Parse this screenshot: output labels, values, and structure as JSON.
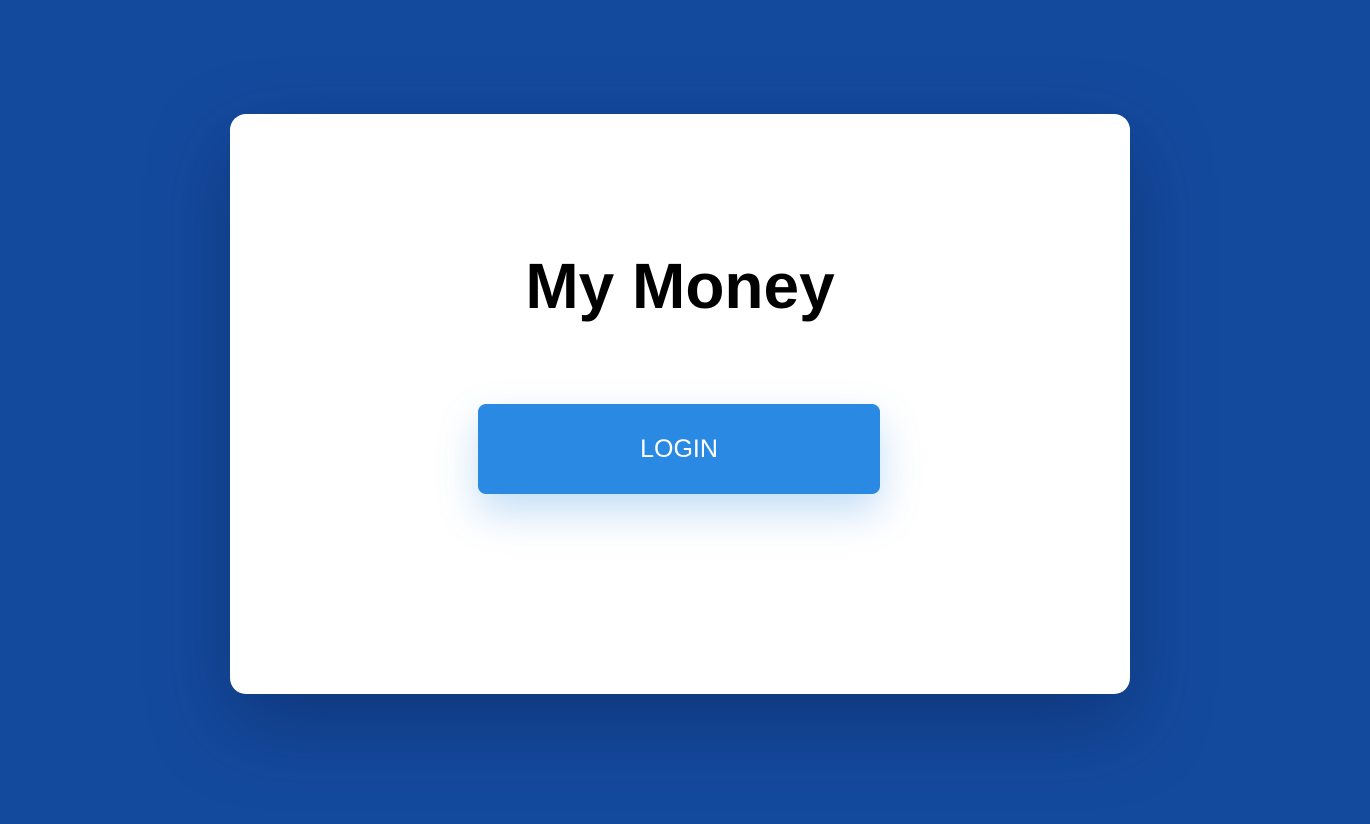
{
  "app": {
    "title": "My Money"
  },
  "actions": {
    "login_label": "LOGIN"
  },
  "colors": {
    "background": "#144a9e",
    "card": "#ffffff",
    "primary_button": "#2a8ae3",
    "title_text": "#000000",
    "button_text": "#ffffff"
  }
}
